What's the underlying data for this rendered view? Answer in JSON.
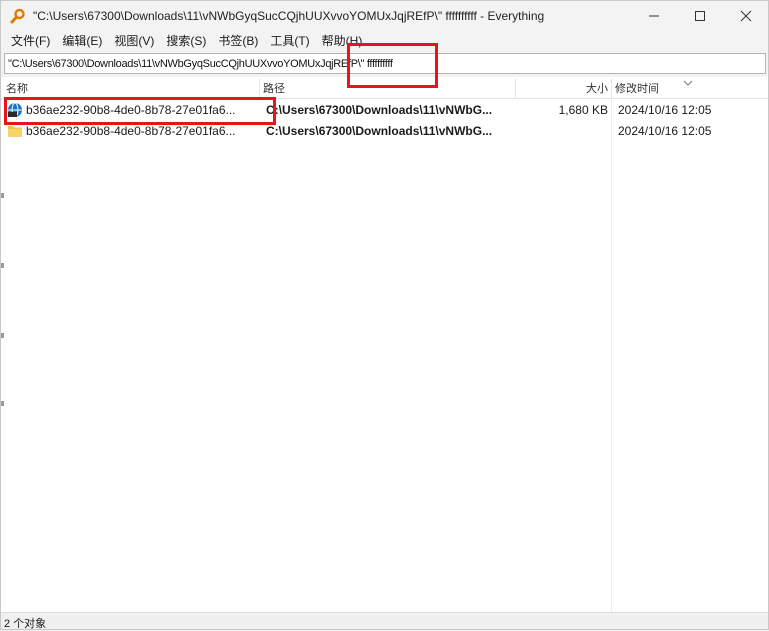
{
  "window": {
    "title": "\"C:\\Users\\67300\\Downloads\\11\\vNWbGyqSucCQjhUUXvvoYOMUxJqjREfP\\\" ffffffffff - Everything"
  },
  "menu": {
    "items": [
      {
        "label": "文件(F)"
      },
      {
        "label": "编辑(E)"
      },
      {
        "label": "视图(V)"
      },
      {
        "label": "搜索(S)"
      },
      {
        "label": "书签(B)"
      },
      {
        "label": "工具(T)"
      },
      {
        "label": "帮助(H)"
      }
    ]
  },
  "search": {
    "value": "\"C:\\Users\\67300\\Downloads\\11\\vNWbGyqSucCQjhUUXvvoYOMUxJqjREfP\\\" ffffffffff"
  },
  "columns": {
    "name": "名称",
    "path": "路径",
    "size": "大小",
    "modified": "修改时间"
  },
  "results": [
    {
      "icon": "app-globe-icon",
      "name": "b36ae232-90b8-4de0-8b78-27e01fa6...",
      "path": "C:\\Users\\67300\\Downloads\\11\\vNWbG...",
      "size": "1,680 KB",
      "modified": "2024/10/16 12:05"
    },
    {
      "icon": "folder-icon",
      "name": "b36ae232-90b8-4de0-8b78-27e01fa6...",
      "path": "C:\\Users\\67300\\Downloads\\11\\vNWbG...",
      "size": "",
      "modified": "2024/10/16 12:05"
    }
  ],
  "status": {
    "count_text": "2 个对象"
  },
  "colors": {
    "highlight": "#e8141b",
    "folder": "#f5c542",
    "app_icon": "#1a73c9"
  }
}
